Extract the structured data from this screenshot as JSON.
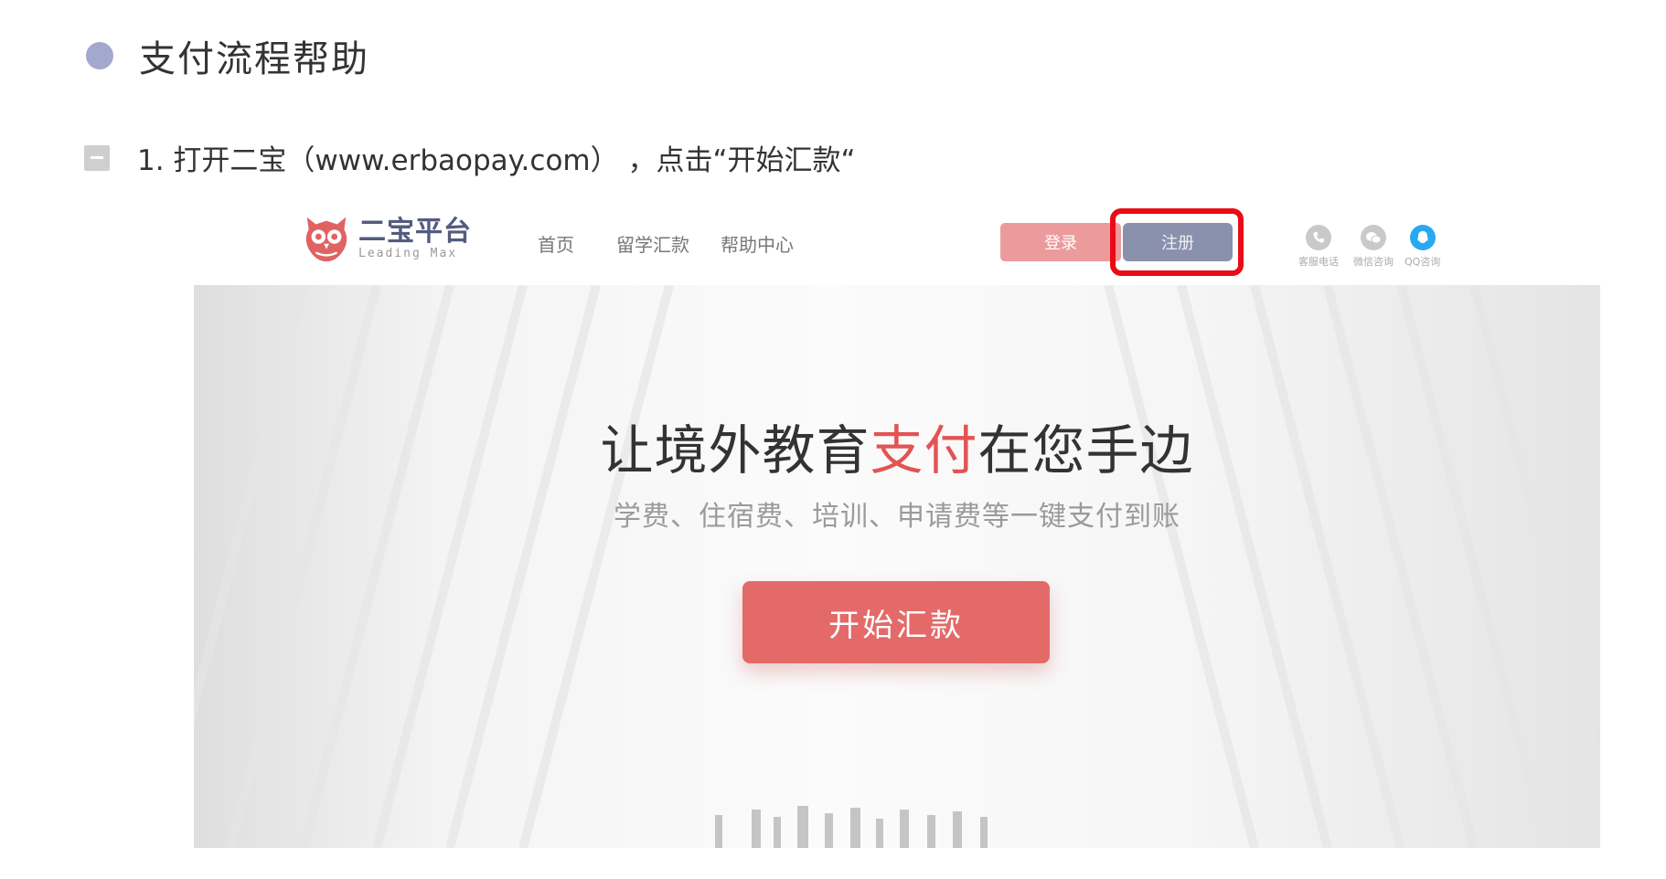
{
  "colors": {
    "section_dot": "#a3a8ce",
    "highlight_border": "#ea0b16",
    "login_button": "#eb9b9b",
    "register_button": "#8a91ad",
    "cta_button": "#e46a6a",
    "accent_text": "#e25454",
    "logo_text": "#545b7e",
    "qq_icon": "#29a8f2"
  },
  "section": {
    "title": "支付流程帮助",
    "icon": "circle-bullet-icon"
  },
  "step": {
    "icon": "collapse-minus-icon",
    "text": "1. 打开二宝（www.erbaopay.com） ，点击“开始汇款“"
  },
  "embedded_site": {
    "logo": {
      "name": "二宝平台",
      "tagline": "Leading Max",
      "icon": "owl-logo-icon"
    },
    "nav": [
      {
        "label": "首页"
      },
      {
        "label": "留学汇款"
      },
      {
        "label": "帮助中心"
      }
    ],
    "buttons": {
      "login": "登录",
      "register": "注册"
    },
    "contacts": [
      {
        "label": "客服电话",
        "icon": "phone-icon"
      },
      {
        "label": "微信咨询",
        "icon": "wechat-icon"
      },
      {
        "label": "QQ咨询",
        "icon": "qq-icon"
      }
    ],
    "hero": {
      "headline_before": "让境外教育",
      "headline_accent": "支付",
      "headline_after": "在您手边",
      "subheadline": "学费、住宿费、培训、申请费等一键支付到账",
      "cta": "开始汇款"
    }
  }
}
